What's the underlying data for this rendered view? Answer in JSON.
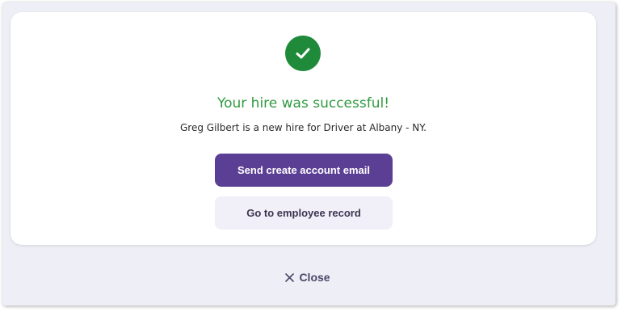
{
  "dialog": {
    "headline": "Your hire was successful!",
    "message": "Greg Gilbert is a new hire for Driver at Albany - NY.",
    "primary_button": "Send create account email",
    "secondary_button": "Go to employee record",
    "close_label": "Close",
    "icons": {
      "status": "check-circle-icon",
      "close": "close-x-icon"
    },
    "colors": {
      "success_green": "#1e8a3a",
      "headline_green": "#2f9a3f",
      "primary_purple": "#5b3f95",
      "secondary_bg": "#f1eff8",
      "backdrop": "#eeeff6"
    }
  }
}
